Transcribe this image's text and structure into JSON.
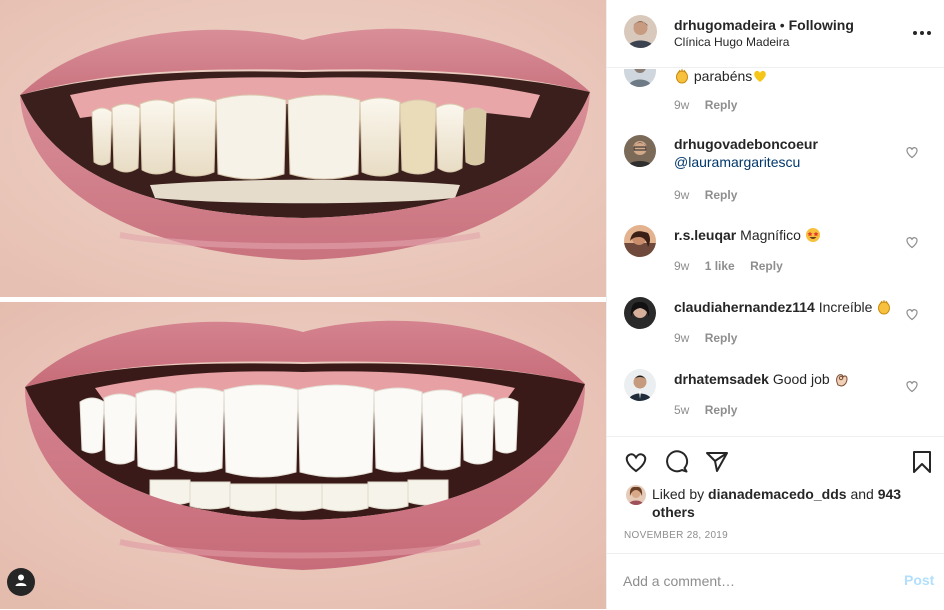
{
  "post": {
    "username": "drhugomadeira",
    "separator": "•",
    "follow_status": "Following",
    "location": "Clínica Hugo Madeira",
    "more_icon": "more-horizontal-icon"
  },
  "comments": [
    {
      "username": "",
      "text": "parabéns",
      "time": "9w",
      "likes": "",
      "reply": "Reply"
    },
    {
      "username": "drhugovadeboncoeur",
      "text": "@lauramargaritescu",
      "time": "9w",
      "likes": "",
      "reply": "Reply"
    },
    {
      "username": "r.s.leuqar",
      "text": "Magnífico",
      "time": "9w",
      "likes": "1 like",
      "reply": "Reply"
    },
    {
      "username": "claudiahernandez114",
      "text": "Increíble",
      "time": "9w",
      "likes": "",
      "reply": "Reply"
    },
    {
      "username": "drhatemsadek",
      "text": "Good job",
      "time": "5w",
      "likes": "",
      "reply": "Reply"
    }
  ],
  "actions": {
    "like_icon": "heart-icon",
    "comment_icon": "comment-icon",
    "share_icon": "share-icon",
    "save_icon": "bookmark-icon"
  },
  "likes": {
    "prefix": "Liked by",
    "user": "dianademacedo_dds",
    "and": "and",
    "others": "943 others"
  },
  "date": "NOVEMBER 28, 2019",
  "add_comment": {
    "placeholder": "Add a comment…",
    "post_label": "Post"
  },
  "colors": {
    "link": "#00376b",
    "muted": "#8e8e8e",
    "post_button_disabled": "#b2dffc"
  }
}
